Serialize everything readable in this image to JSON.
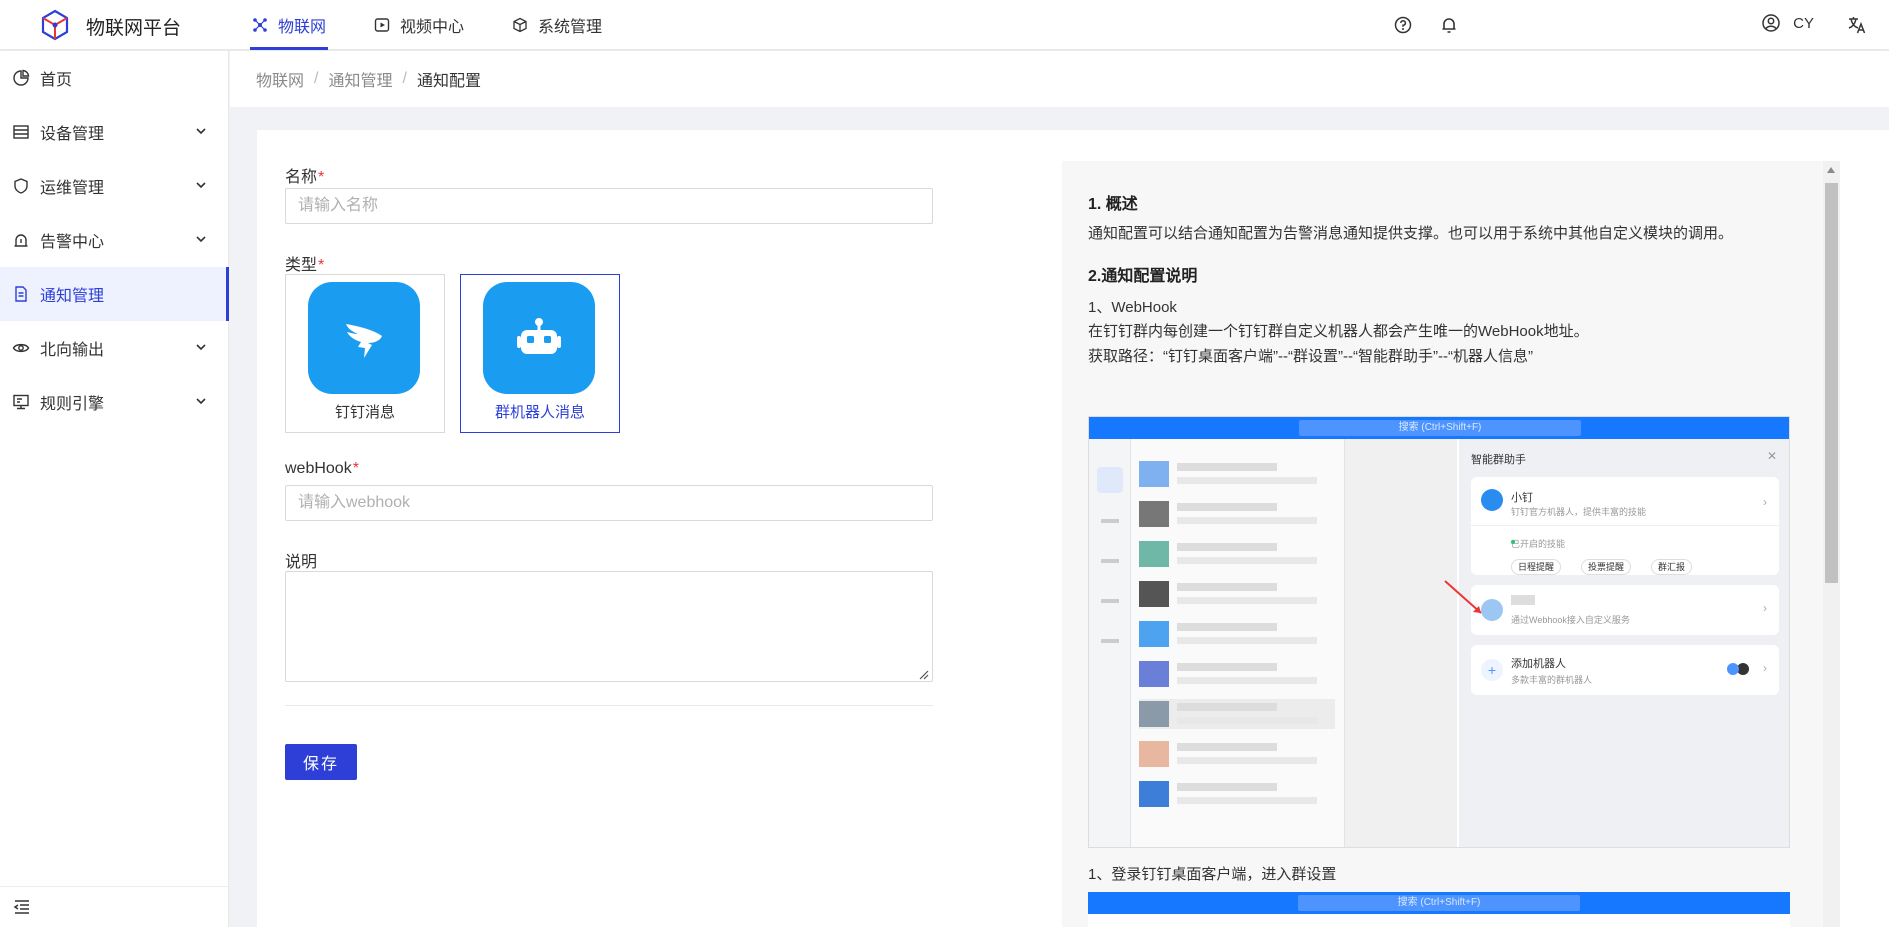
{
  "app": {
    "title": "物联网平台"
  },
  "topnav": [
    {
      "label": "物联网",
      "icon": "iot-icon",
      "active": true
    },
    {
      "label": "视频中心",
      "icon": "video-icon",
      "active": false
    },
    {
      "label": "系统管理",
      "icon": "cube-icon",
      "active": false
    }
  ],
  "user": {
    "name": "CY"
  },
  "sidebar": {
    "items": [
      {
        "label": "首页",
        "icon": "pie-chart-icon",
        "expandable": false
      },
      {
        "label": "设备管理",
        "icon": "device-icon",
        "expandable": true
      },
      {
        "label": "运维管理",
        "icon": "shield-icon",
        "expandable": true
      },
      {
        "label": "告警中心",
        "icon": "alarm-icon",
        "expandable": true
      },
      {
        "label": "通知管理",
        "icon": "doc-icon",
        "expandable": false,
        "active": true
      },
      {
        "label": "北向输出",
        "icon": "eye-icon",
        "expandable": true
      },
      {
        "label": "规则引擎",
        "icon": "rules-icon",
        "expandable": true
      }
    ]
  },
  "breadcrumb": [
    "物联网",
    "通知管理",
    "通知配置"
  ],
  "form": {
    "name_label": "名称",
    "name_placeholder": "请输入名称",
    "type_label": "类型",
    "types": [
      {
        "label": "钉钉消息",
        "icon": "dingtalk-icon",
        "selected": false
      },
      {
        "label": "群机器人消息",
        "icon": "robot-icon",
        "selected": true
      }
    ],
    "webhook_label": "webHook",
    "webhook_placeholder": "请输入webhook",
    "desc_label": "说明",
    "required_mark": "*",
    "save_label": "保存"
  },
  "doc": {
    "h1": "1. 概述",
    "p1": "通知配置可以结合通知配置为告警消息通知提供支撑。也可以用于系统中其他自定义模块的调用。",
    "h2": "2.通知配置说明",
    "p2": "1、WebHook",
    "p3": "在钉钉群内每创建一个钉钉群自定义机器人都会产生唯一的WebHook地址。",
    "p4": "获取路径：“钉钉桌面客户端”--“群设置”--“智能群助手”--“机器人信息”",
    "p5": "1、登录钉钉桌面客户端，进入群设置",
    "shot": {
      "search": "搜索 (Ctrl+Shift+F)",
      "panel_title": "智能群助手",
      "bot1_name": "小钉",
      "bot1_desc": "钉钉官方机器人，提供丰富的技能",
      "bot1_status": "已开启的技能",
      "chips": [
        "日程提醒",
        "投票提醒",
        "群汇报"
      ],
      "bot2_desc": "通过Webhook接入自定义服务",
      "add_name": "添加机器人",
      "add_desc": "多款丰富的群机器人"
    },
    "shot2": {
      "search": "搜索 (Ctrl+Shift+F)"
    }
  },
  "colors": {
    "primary": "#2d3fd6",
    "dingtalk_blue": "#1a9cf0",
    "required": "#e33333"
  }
}
